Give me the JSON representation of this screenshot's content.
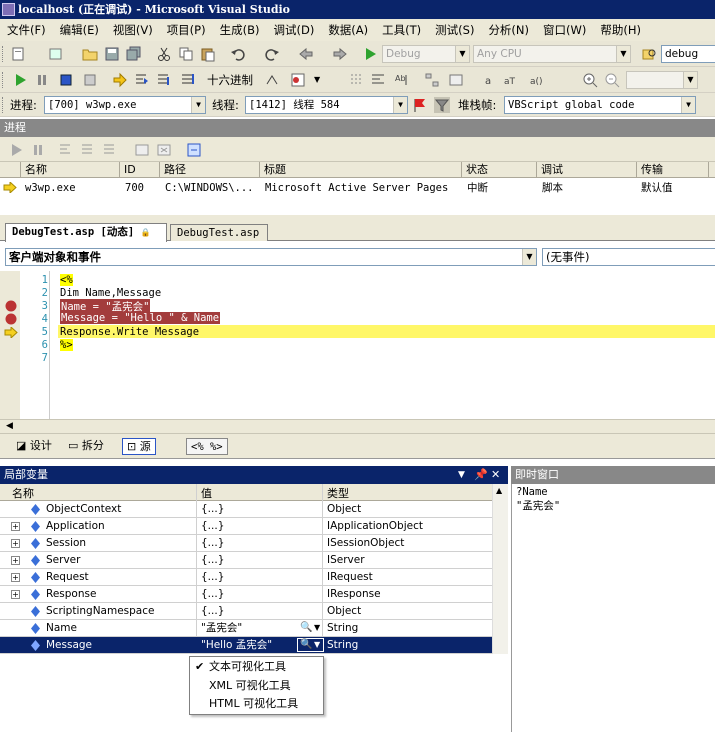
{
  "window": {
    "title": "localhost (正在调试) - Microsoft Visual Studio"
  },
  "menu": [
    "文件(F)",
    "编辑(E)",
    "视图(V)",
    "项目(P)",
    "生成(B)",
    "调试(D)",
    "数据(A)",
    "工具(T)",
    "测试(S)",
    "分析(N)",
    "窗口(W)",
    "帮助(H)"
  ],
  "toolbar1": {
    "config_combo": "Debug",
    "platform_combo": "Any CPU",
    "find_value": "debug"
  },
  "toolbar2": {
    "hex_label": "十六进制"
  },
  "toolbar3": {
    "process_label": "进程:",
    "process_value": "[700] w3wp.exe",
    "thread_label": "线程:",
    "thread_value": "[1412] 线程 584",
    "stack_label": "堆栈帧:",
    "stack_value": "VBScript global code"
  },
  "processes": {
    "title": "进程",
    "columns": [
      "名称",
      "ID",
      "路径",
      "标题",
      "状态",
      "调试",
      "传输"
    ],
    "rows": [
      {
        "name": "w3wp.exe",
        "id": "700",
        "path": "C:\\WINDOWS\\...",
        "title": "Microsoft Active Server Pages",
        "state": "中断",
        "debug": "脚本",
        "transport": "默认值"
      }
    ]
  },
  "editor": {
    "tabs": [
      "DebugTest.asp [动态]",
      "DebugTest.asp"
    ],
    "object_combo": "客户端对象和事件",
    "event_combo": "(无事件)",
    "lines": [
      {
        "num": "1",
        "text": "<%"
      },
      {
        "num": "2",
        "text": "Dim Name,Message"
      },
      {
        "num": "3",
        "text": "Name = \"孟宪会\""
      },
      {
        "num": "4",
        "text": "Message = \"Hello \" & Name"
      },
      {
        "num": "5",
        "text": "Response.Write Message"
      },
      {
        "num": "6",
        "text": "%>"
      },
      {
        "num": "7",
        "text": ""
      }
    ],
    "view_buttons": [
      "设计",
      "拆分",
      "源"
    ],
    "tag_crumb": "<%  %>"
  },
  "locals": {
    "title": "局部变量",
    "columns": [
      "名称",
      "值",
      "类型"
    ],
    "rows": [
      {
        "name": "ObjectContext",
        "value": "{...}",
        "type": "Object",
        "expandable": false
      },
      {
        "name": "Application",
        "value": "{...}",
        "type": "IApplicationObject",
        "expandable": true
      },
      {
        "name": "Session",
        "value": "{...}",
        "type": "ISessionObject",
        "expandable": true
      },
      {
        "name": "Server",
        "value": "{...}",
        "type": "IServer",
        "expandable": true
      },
      {
        "name": "Request",
        "value": "{...}",
        "type": "IRequest",
        "expandable": true
      },
      {
        "name": "Response",
        "value": "{...}",
        "type": "IResponse",
        "expandable": true
      },
      {
        "name": "ScriptingNamespace",
        "value": "{...}",
        "type": "Object",
        "expandable": false
      },
      {
        "name": "Name",
        "value": "\"孟宪会\"",
        "type": "String",
        "expandable": false
      },
      {
        "name": "Message",
        "value": "\"Hello 孟宪会\"",
        "type": "String",
        "expandable": false
      }
    ]
  },
  "immediate": {
    "title": "即时窗口",
    "lines": [
      "?Name",
      "\"孟宪会\""
    ]
  },
  "context_menu": {
    "items": [
      "文本可视化工具",
      "XML 可视化工具",
      "HTML 可视化工具"
    ]
  },
  "colors": {
    "title_bar": "#0a246a",
    "breakpoint": "#a33c3c",
    "current_line": "#fff768",
    "menu_bar": "#ece9d8"
  }
}
